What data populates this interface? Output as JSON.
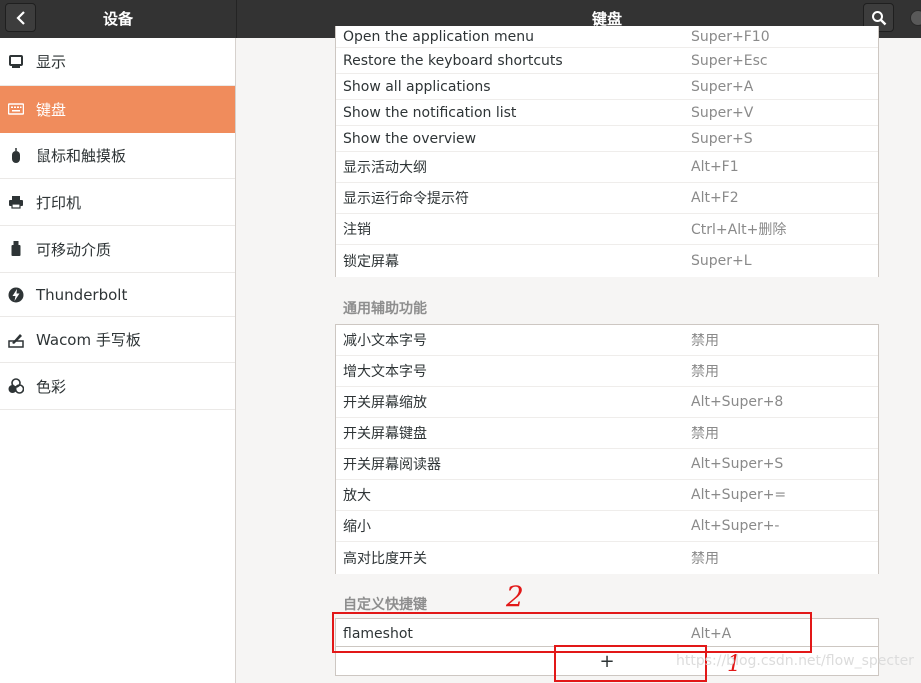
{
  "header": {
    "left_title": "设备",
    "main_title": "键盘",
    "back_icon": "chevron-left-icon",
    "search_icon": "search-icon"
  },
  "sidebar": {
    "items": [
      {
        "label": "显示",
        "icon": "display-icon"
      },
      {
        "label": "键盘",
        "icon": "keyboard-icon",
        "active": true
      },
      {
        "label": "鼠标和触摸板",
        "icon": "mouse-icon"
      },
      {
        "label": "打印机",
        "icon": "printer-icon"
      },
      {
        "label": "可移动介质",
        "icon": "usb-drive-icon"
      },
      {
        "label": "Thunderbolt",
        "icon": "thunderbolt-icon"
      },
      {
        "label": "Wacom 手写板",
        "icon": "tablet-icon"
      },
      {
        "label": "色彩",
        "icon": "color-icon"
      }
    ],
    "accent_color": "#f08c5c"
  },
  "system_shortcuts": [
    {
      "name": "Open the application menu",
      "accel": "Super+F10"
    },
    {
      "name": "Restore the keyboard shortcuts",
      "accel": "Super+Esc"
    },
    {
      "name": "Show all applications",
      "accel": "Super+A"
    },
    {
      "name": "Show the notification list",
      "accel": "Super+V"
    },
    {
      "name": "Show the overview",
      "accel": "Super+S"
    },
    {
      "name": "显示活动大纲",
      "accel": "Alt+F1"
    },
    {
      "name": "显示运行命令提示符",
      "accel": "Alt+F2"
    },
    {
      "name": "注销",
      "accel": "Ctrl+Alt+删除"
    },
    {
      "name": "锁定屏幕",
      "accel": "Super+L"
    }
  ],
  "accessibility": {
    "heading": "通用辅助功能",
    "rows": [
      {
        "name": "减小文本字号",
        "accel": "禁用"
      },
      {
        "name": "增大文本字号",
        "accel": "禁用"
      },
      {
        "name": "开关屏幕缩放",
        "accel": "Alt+Super+8"
      },
      {
        "name": "开关屏幕键盘",
        "accel": "禁用"
      },
      {
        "name": "开关屏幕阅读器",
        "accel": "Alt+Super+S"
      },
      {
        "name": "放大",
        "accel": "Alt+Super+="
      },
      {
        "name": "缩小",
        "accel": "Alt+Super+-"
      },
      {
        "name": "高对比度开关",
        "accel": "禁用"
      }
    ]
  },
  "custom": {
    "heading": "自定义快捷键",
    "rows": [
      {
        "name": "flameshot",
        "accel": "Alt+A"
      }
    ],
    "add_label": "+"
  },
  "annotations": {
    "mark_1": "1",
    "mark_2": "2",
    "color": "#e21818"
  },
  "watermark": "https://blog.csdn.net/flow_specter"
}
